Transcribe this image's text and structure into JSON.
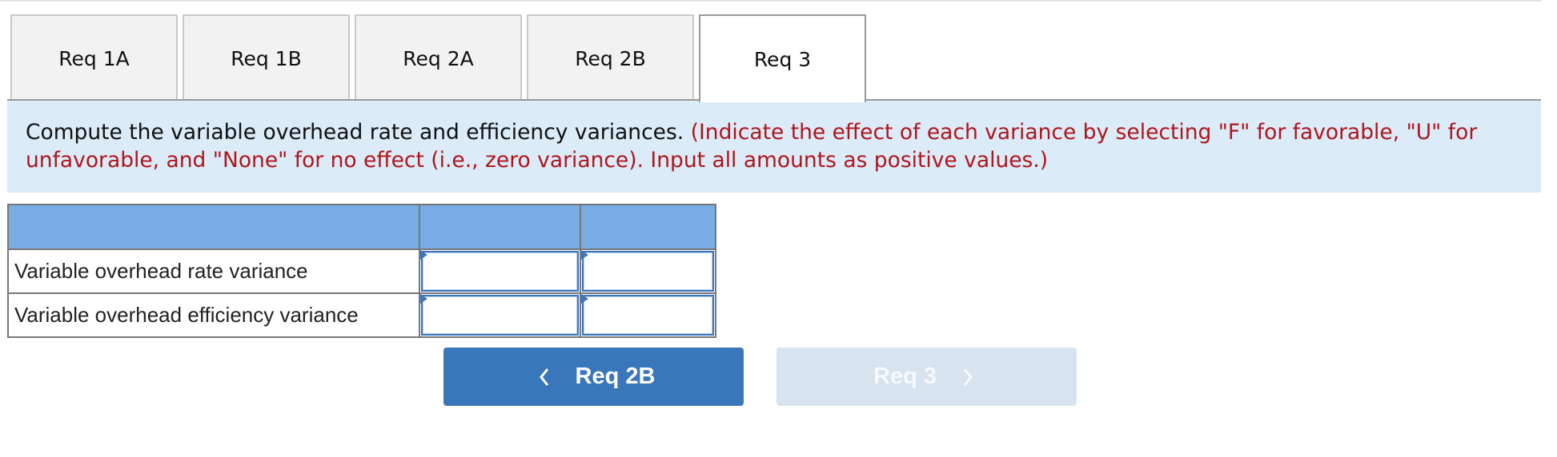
{
  "tabs": [
    {
      "label": "Req 1A",
      "active": false
    },
    {
      "label": "Req 1B",
      "active": false
    },
    {
      "label": "Req 2A",
      "active": false
    },
    {
      "label": "Req 2B",
      "active": false
    },
    {
      "label": "Req 3",
      "active": true
    }
  ],
  "instructions": {
    "main": "Compute the variable overhead rate and efficiency variances.",
    "note": "(Indicate the effect of each variance by selecting \"F\" for favorable, \"U\" for unfavorable, and \"None\" for no effect (i.e., zero variance). Input all amounts as positive values.)"
  },
  "table": {
    "headers": [
      "",
      "",
      ""
    ],
    "rows": [
      {
        "label": "Variable overhead rate variance",
        "amount": "",
        "effect": ""
      },
      {
        "label": "Variable overhead efficiency variance",
        "amount": "",
        "effect": ""
      }
    ]
  },
  "navigation": {
    "prev_label": "Req 2B",
    "prev_icon": "chevron-left-icon",
    "next_label": "Req 3",
    "next_icon": "chevron-right-icon",
    "next_disabled": true
  },
  "colors": {
    "accent": "#3a77ba",
    "header_bg": "#78ace3",
    "info_bg": "#dbebf8",
    "note_red": "#b0161c",
    "disabled_btn": "#d8e3f0"
  }
}
